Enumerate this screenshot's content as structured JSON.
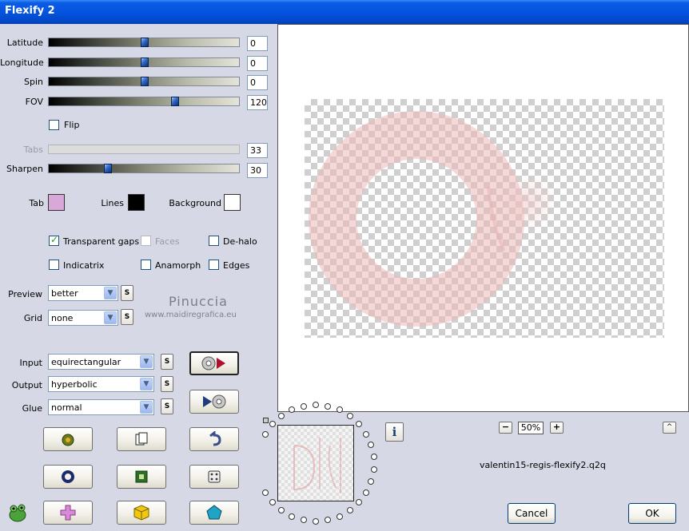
{
  "window": {
    "title": "Flexify 2"
  },
  "sliders": {
    "latitude": {
      "label": "Latitude",
      "value": "0",
      "position": 0.5
    },
    "longitude": {
      "label": "Longitude",
      "value": "0",
      "position": 0.5
    },
    "spin": {
      "label": "Spin",
      "value": "0",
      "position": 0.5
    },
    "fov": {
      "label": "FOV",
      "value": "120",
      "position": 0.66
    },
    "tabs": {
      "label": "Tabs",
      "value": "33",
      "position": 0.33
    },
    "sharpen": {
      "label": "Sharpen",
      "value": "30",
      "position": 0.3
    }
  },
  "checkboxes": {
    "flip": {
      "label": "Flip",
      "checked": false
    },
    "transparent_gaps": {
      "label": "Transparent gaps",
      "checked": true
    },
    "faces": {
      "label": "Faces",
      "checked": false
    },
    "de_halo": {
      "label": "De-halo",
      "checked": false
    },
    "indicatrix": {
      "label": "Indicatrix",
      "checked": false
    },
    "anamorph": {
      "label": "Anamorph",
      "checked": false
    },
    "edges": {
      "label": "Edges",
      "checked": false
    }
  },
  "colors": {
    "tab": {
      "label": "Tab",
      "color": "#d8a8d8"
    },
    "lines": {
      "label": "Lines",
      "color": "#000000"
    },
    "background": {
      "label": "Background",
      "color": "#ffffff"
    }
  },
  "selects": {
    "preview": {
      "label": "Preview",
      "value": "better"
    },
    "grid": {
      "label": "Grid",
      "value": "none"
    },
    "input": {
      "label": "Input",
      "value": "equirectangular"
    },
    "output": {
      "label": "Output",
      "value": "hyperbolic"
    },
    "glue": {
      "label": "Glue",
      "value": "normal"
    }
  },
  "small_button_label": "S",
  "watermark": {
    "name": "Pinuccia",
    "site": "www.maidiregrafica.eu"
  },
  "zoom": {
    "minus": "−",
    "value": "50%",
    "plus": "+"
  },
  "filename": "valentin15-regis-flexify2.q2q",
  "buttons": {
    "cancel": "Cancel",
    "ok": "OK",
    "info": "i",
    "up": "^"
  },
  "icons": {
    "convert_forward": "disc-play-icon",
    "convert_back": "play-disc-icon",
    "randomize": "grenade-icon",
    "copy": "copy-pages-icon",
    "undo": "undo-arrow-icon",
    "circle": "ring-icon",
    "frame": "square-frame-icon",
    "dice": "dice-icon",
    "plugin": "plugin-frog-icon",
    "cross": "cross-shape-icon",
    "cube": "cube-icon",
    "pentagon": "pentagon-icon"
  }
}
